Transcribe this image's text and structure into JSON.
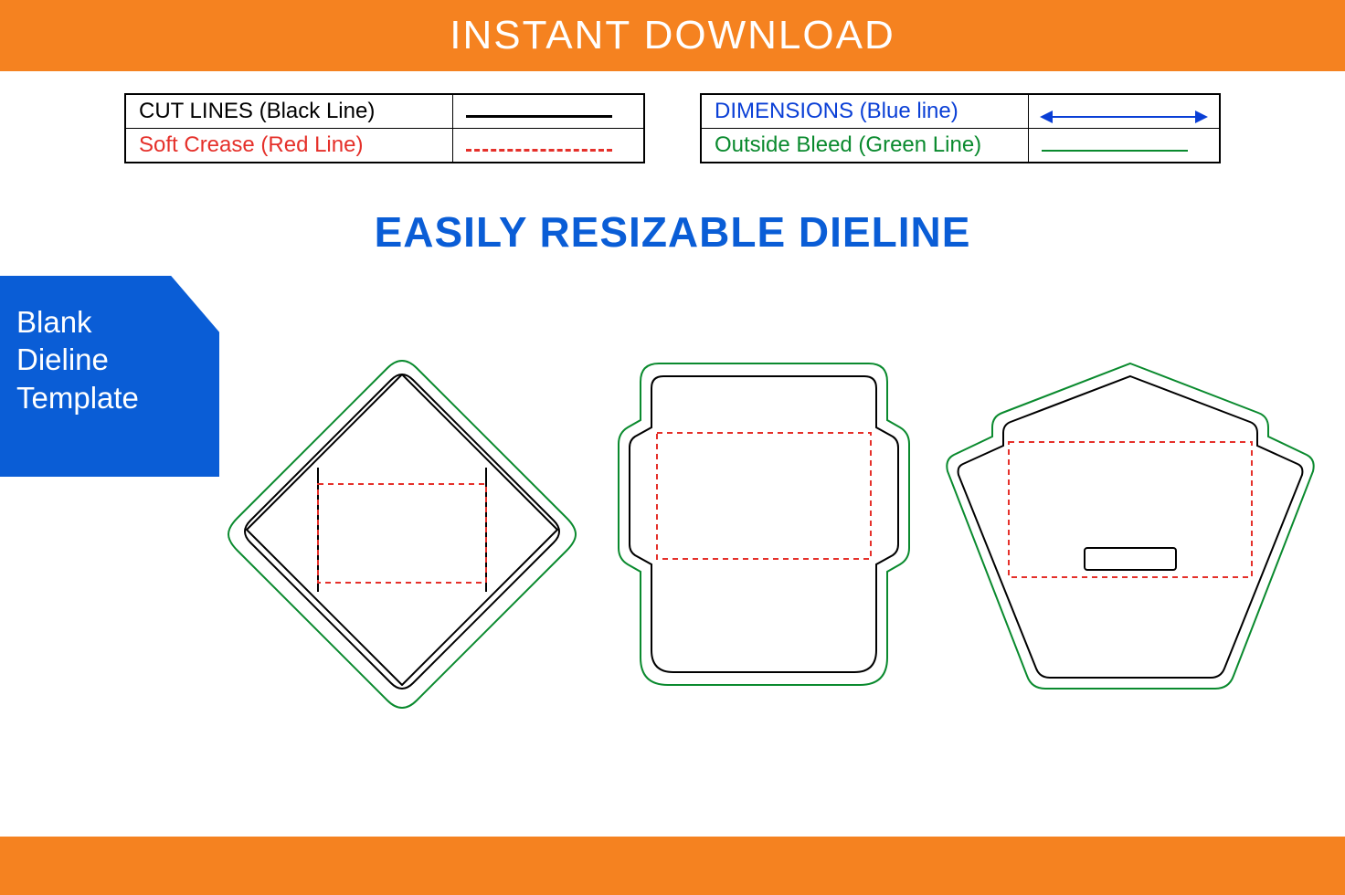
{
  "header": {
    "title": "INSTANT DOWNLOAD"
  },
  "legend": {
    "left": {
      "row1": "CUT LINES (Black Line)",
      "row2": "Soft Crease (Red Line)"
    },
    "right": {
      "row1": "DIMENSIONS (Blue line)",
      "row2": "Outside Bleed (Green Line)"
    }
  },
  "subtitle": "EASILY RESIZABLE DIELINE",
  "badge": {
    "line1": "Blank",
    "line2": "Dieline",
    "line3": "Template"
  },
  "colors": {
    "orange": "#f58220",
    "blue": "#0a5dd6",
    "red": "#e5302a",
    "green": "#0a8a2e",
    "black": "#000000"
  }
}
